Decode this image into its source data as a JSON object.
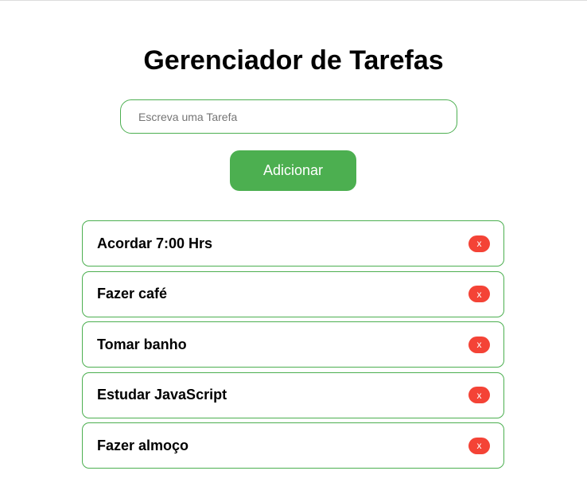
{
  "app": {
    "title": "Gerenciador de Tarefas"
  },
  "input": {
    "placeholder": "Escreva uma Tarefa",
    "value": ""
  },
  "add_button": {
    "label": "Adicionar"
  },
  "tasks": [
    {
      "text": "Acordar 7:00 Hrs",
      "delete_label": "x"
    },
    {
      "text": "Fazer café",
      "delete_label": "x"
    },
    {
      "text": "Tomar banho",
      "delete_label": "x"
    },
    {
      "text": "Estudar JavaScript",
      "delete_label": "x"
    },
    {
      "text": "Fazer almoço",
      "delete_label": "x"
    }
  ],
  "colors": {
    "accent": "#4caf50",
    "danger": "#f44336"
  }
}
